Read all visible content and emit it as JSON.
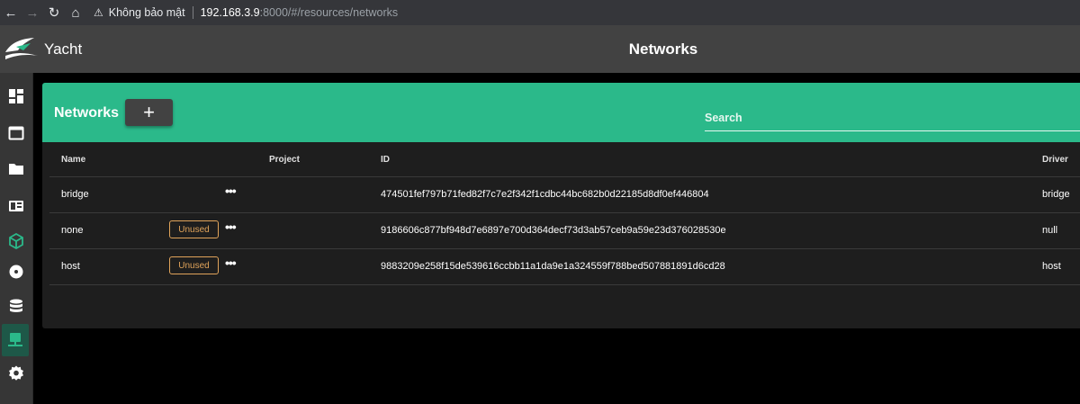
{
  "browser": {
    "back_icon": "←",
    "forward_icon": "→",
    "reload_icon": "↻",
    "home_icon": "⌂",
    "warning_icon": "⚠",
    "security_label": "Không bảo mật",
    "url_host": "192.168.3.9",
    "url_rest": ":8000/#/resources/networks"
  },
  "app": {
    "name": "Yacht",
    "page_title": "Networks"
  },
  "sidebar": {
    "items": [
      {
        "icon": "dashboard-icon"
      },
      {
        "icon": "applications-icon"
      },
      {
        "icon": "projects-icon"
      },
      {
        "icon": "templates-icon"
      },
      {
        "icon": "resources-icon"
      },
      {
        "icon": "images-icon"
      },
      {
        "icon": "volumes-icon"
      },
      {
        "icon": "networks-icon",
        "active": true
      },
      {
        "icon": "settings-icon"
      }
    ],
    "accent": "#2bb98a"
  },
  "card": {
    "title": "Networks",
    "add_label": "+",
    "search_placeholder": "Search",
    "header_color": "#2bb98a"
  },
  "table": {
    "columns": [
      "Name",
      "Project",
      "ID",
      "Driver"
    ],
    "rows": [
      {
        "name": "bridge",
        "badge": "",
        "actions": "•••",
        "project": "",
        "id": "474501fef797b71fed82f7c7e2f342f1cdbc44bc682b0d22185d8df0ef446804",
        "driver": "bridge"
      },
      {
        "name": "none",
        "badge": "Unused",
        "actions": "•••",
        "project": "",
        "id": "9186606c877bf948d7e6897e700d364decf73d3ab57ceb9a59e23d376028530e",
        "driver": "null"
      },
      {
        "name": "host",
        "badge": "Unused",
        "actions": "•••",
        "project": "",
        "id": "9883209e258f15de539616ccbb11a1da9e1a324559f788bed507881891d6cd28",
        "driver": "host"
      }
    ]
  }
}
